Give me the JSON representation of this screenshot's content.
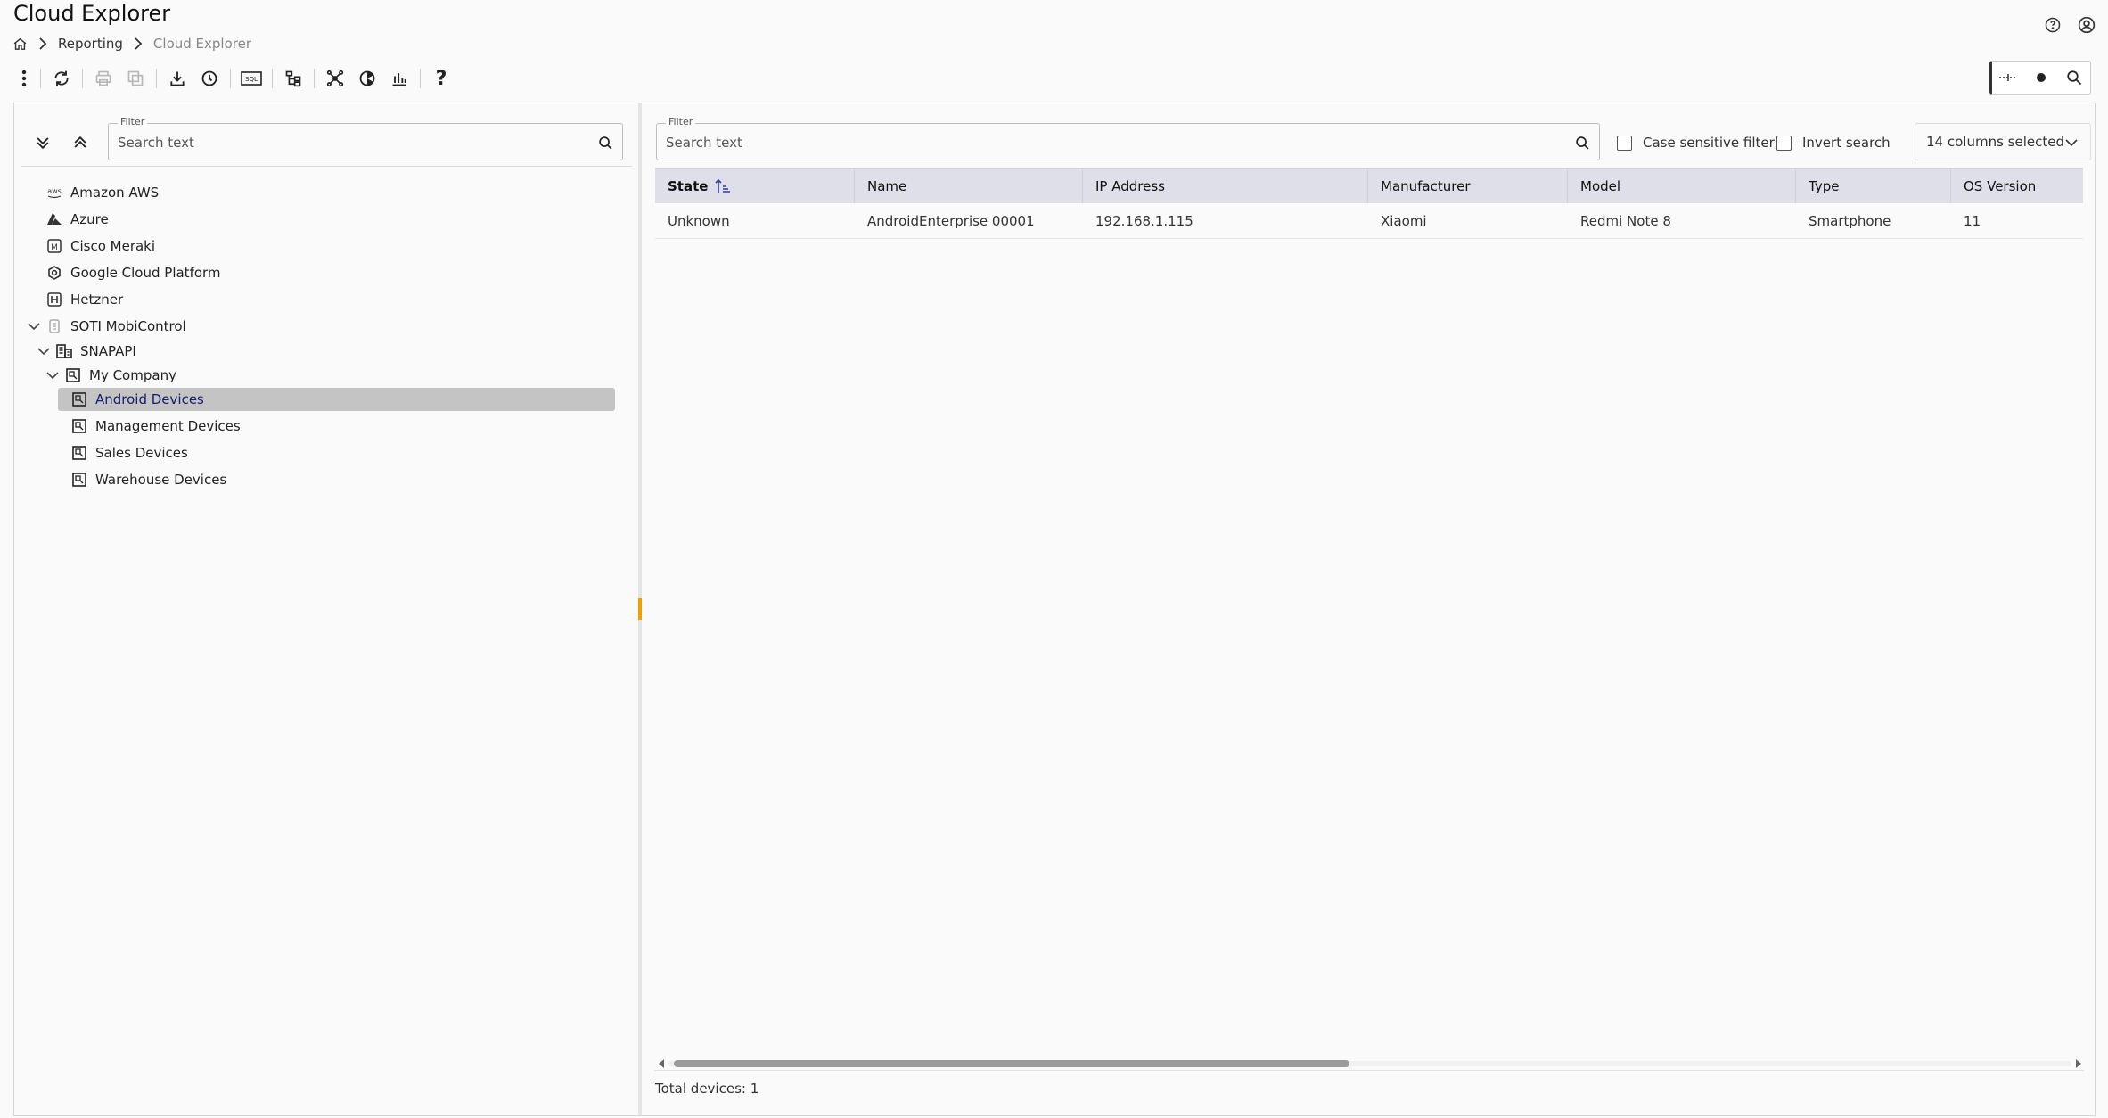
{
  "app": {
    "title": "Cloud Explorer"
  },
  "breadcrumb": {
    "items": [
      "Reporting",
      "Cloud Explorer"
    ]
  },
  "toolbar": {
    "icons": [
      "more-vertical-icon",
      "refresh-icon",
      "print-icon",
      "copy-icon",
      "download-icon",
      "history-icon",
      "sql-icon",
      "hierarchy-icon",
      "network-icon",
      "pie-chart-icon",
      "bar-chart-icon",
      "help-icon"
    ],
    "sql_label": "SQL",
    "help_label": "?"
  },
  "tree_filter": {
    "label": "Filter",
    "placeholder": "Search text"
  },
  "tree": {
    "nodes": [
      {
        "label": "Amazon AWS",
        "icon": "aws-icon"
      },
      {
        "label": "Azure",
        "icon": "azure-icon"
      },
      {
        "label": "Cisco Meraki",
        "icon": "meraki-icon"
      },
      {
        "label": "Google Cloud Platform",
        "icon": "gcp-icon"
      },
      {
        "label": "Hetzner",
        "icon": "hetzner-icon"
      },
      {
        "label": "SOTI MobiControl",
        "icon": "soti-icon",
        "expanded": true
      },
      {
        "label": "SNAPAPI",
        "icon": "building-icon",
        "expanded": true
      },
      {
        "label": "My Company",
        "icon": "group-icon",
        "expanded": true
      },
      {
        "label": "Android Devices",
        "icon": "group-icon",
        "selected": true
      },
      {
        "label": "Management Devices",
        "icon": "group-icon"
      },
      {
        "label": "Sales Devices",
        "icon": "group-icon"
      },
      {
        "label": "Warehouse Devices",
        "icon": "group-icon"
      }
    ]
  },
  "grid_filter": {
    "label": "Filter",
    "placeholder": "Search text"
  },
  "options": {
    "case_sensitive": "Case sensitive filter",
    "invert": "Invert search"
  },
  "columns_selector": {
    "value": "14 columns selected"
  },
  "table": {
    "columns": [
      "State",
      "Name",
      "IP Address",
      "Manufacturer",
      "Model",
      "Type",
      "OS Version"
    ],
    "rows": [
      [
        "Unknown",
        "AndroidEnterprise 00001",
        "192.168.1.115",
        "Xiaomi",
        "Redmi Note 8",
        "Smartphone",
        "11"
      ]
    ]
  },
  "scroll": {
    "horizontal_thumb_fraction": 0.47
  },
  "footer": {
    "total": "Total devices: 1"
  },
  "colors": {
    "accent": "#f0a000",
    "header_bg": "#dedfe9",
    "selected_bg": "#c4c4c4",
    "selected_text": "#1a1a6e"
  }
}
